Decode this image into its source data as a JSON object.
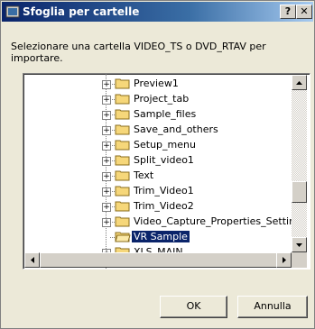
{
  "dialog": {
    "title": "Sfoglia per cartelle",
    "help_label": "?",
    "close_label": "✕",
    "prompt": "Selezionare una cartella VIDEO_TS o DVD_RTAV per importare."
  },
  "tree": {
    "items": [
      {
        "label": "Preview1"
      },
      {
        "label": "Project_tab"
      },
      {
        "label": "Sample_files"
      },
      {
        "label": "Save_and_others"
      },
      {
        "label": "Setup_menu"
      },
      {
        "label": "Split_video1"
      },
      {
        "label": "Text"
      },
      {
        "label": "Trim_Video1"
      },
      {
        "label": "Trim_Video2"
      },
      {
        "label": "Video_Capture_Properties_Settin"
      },
      {
        "label": "VR Sample",
        "selected": true
      },
      {
        "label": "XLS_MAIN"
      }
    ],
    "expander_glyph": "+"
  },
  "buttons": {
    "ok": "OK",
    "cancel": "Annulla"
  },
  "colors": {
    "titlebar_start": "#0a246a",
    "selection": "#0a246a",
    "folder": "#f6d77a"
  }
}
